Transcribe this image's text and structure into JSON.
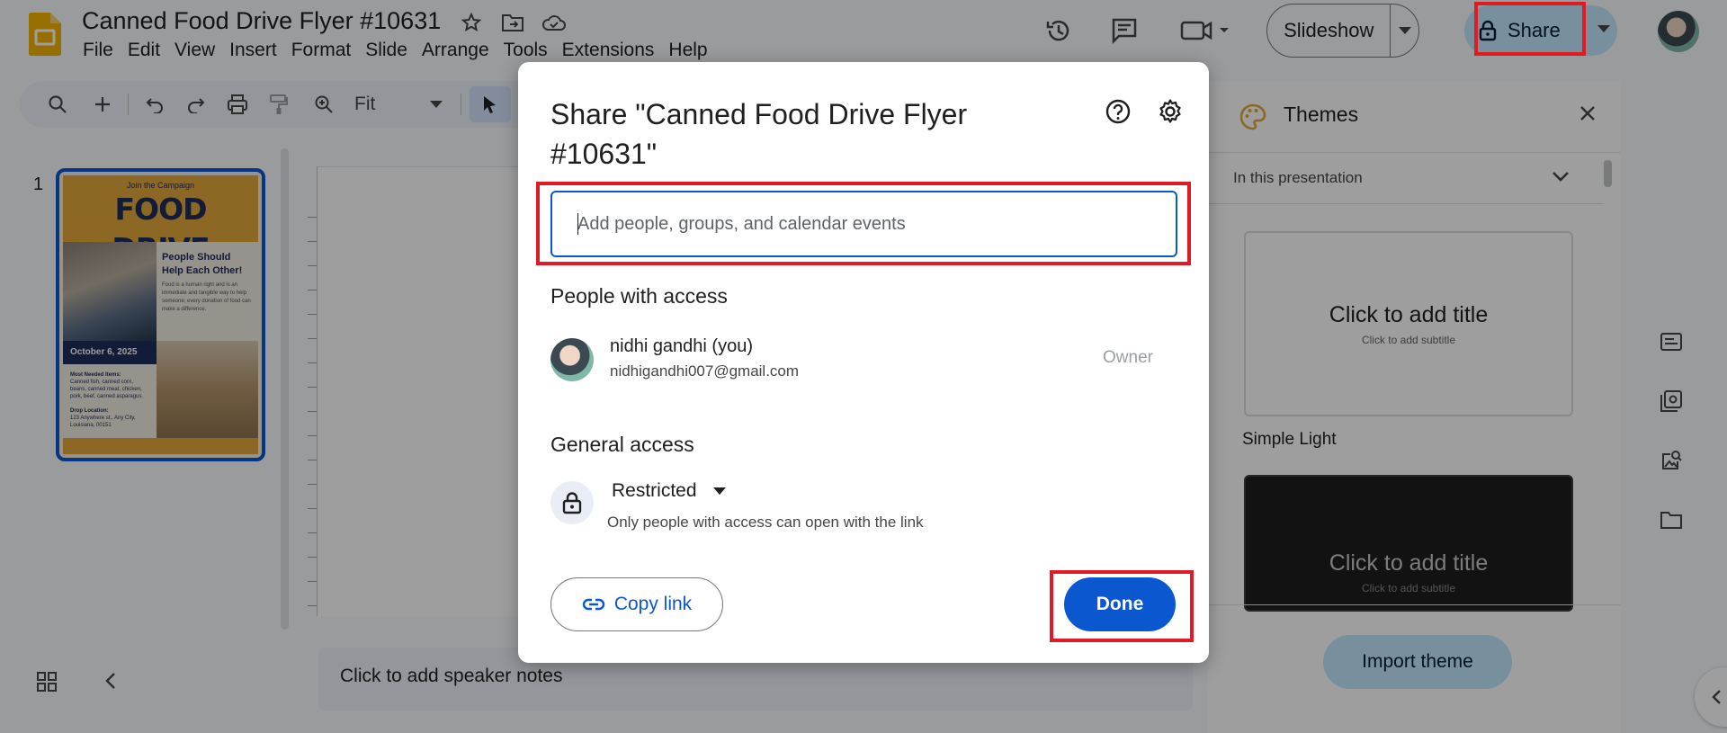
{
  "app": {
    "doc_title": "Canned Food Drive Flyer #10631",
    "menu": [
      "File",
      "Edit",
      "View",
      "Insert",
      "Format",
      "Slide",
      "Arrange",
      "Tools",
      "Extensions",
      "Help"
    ]
  },
  "header": {
    "slideshow_label": "Slideshow",
    "share_label": "Share"
  },
  "toolbar": {
    "zoom_label": "Fit"
  },
  "filmstrip": {
    "slide_number": "1",
    "thumbnail": {
      "kicker": "Join the Campaign",
      "title": "FOOD DRIVE",
      "heading": "People Should Help Each Other!",
      "body": "Food is a human right and is an immediate and tangible way to help someone; every donation of food can make a difference.",
      "date": "October 6, 2025",
      "needed_heading": "Most Needed Items:",
      "needed_body": "Canned fish, canned corn, beans, canned meat, chicken, pork, beef, canned asparagus.",
      "drop_heading": "Drop Location:",
      "drop_body": "123 Anywhere st., Any City, Louisiana, 00151"
    }
  },
  "notes": {
    "placeholder": "Click to add speaker notes"
  },
  "themes": {
    "title": "Themes",
    "filter": "In this presentation",
    "card_title": "Click to add title",
    "card_subtitle": "Click to add subtitle",
    "theme_1_name": "Simple Light",
    "import_label": "Import theme"
  },
  "dialog": {
    "title": "Share \"Canned Food Drive Flyer #10631\"",
    "input_placeholder": "Add people, groups, and calendar events",
    "people_heading": "People with access",
    "person": {
      "name": "nidhi gandhi (you)",
      "email": "nidhigandhi007@gmail.com",
      "role": "Owner"
    },
    "general_heading": "General access",
    "access_level": "Restricted",
    "access_description": "Only people with access can open with the link",
    "copy_link_label": "Copy link",
    "done_label": "Done"
  },
  "colors": {
    "accent": "#0b57d0",
    "share_bg": "#c2e7ff",
    "highlight": "#e01b24"
  },
  "icons": [
    "slides-logo-icon",
    "star-icon",
    "move-folder-icon",
    "cloud-status-icon",
    "history-icon",
    "comment-icon",
    "video-call-icon",
    "lock-icon",
    "help-icon",
    "settings-icon",
    "link-icon",
    "palette-icon",
    "close-icon"
  ]
}
